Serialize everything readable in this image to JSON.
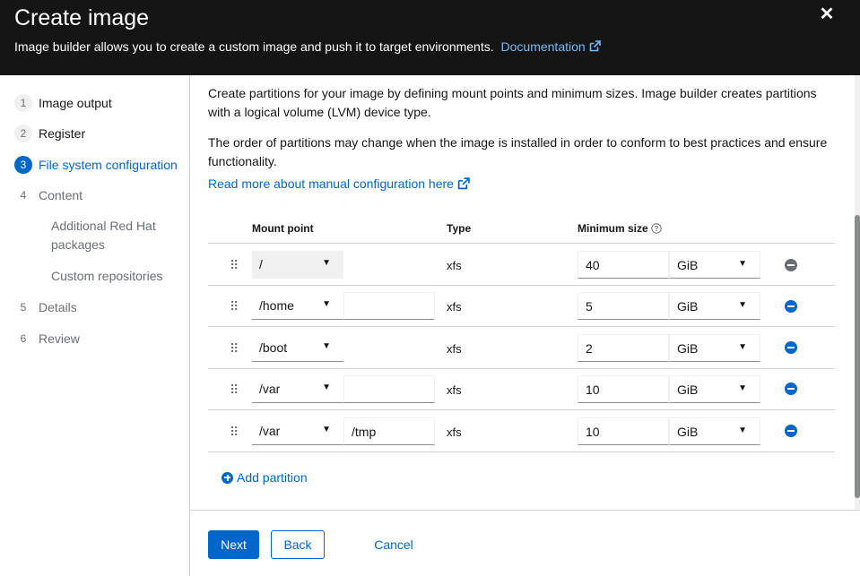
{
  "header": {
    "title": "Create image",
    "description": "Image builder allows you to create a custom image and push it to target environments.",
    "doc_link": "Documentation",
    "close_icon": "close-icon"
  },
  "nav": {
    "steps": [
      {
        "num": "1",
        "label": "Image output"
      },
      {
        "num": "2",
        "label": "Register"
      },
      {
        "num": "3",
        "label": "File system configuration"
      },
      {
        "num": "4",
        "label": "Content"
      },
      {
        "num": "5",
        "label": "Details"
      },
      {
        "num": "6",
        "label": "Review"
      }
    ],
    "substeps": [
      "Additional Red Hat packages",
      "Custom repositories"
    ]
  },
  "main": {
    "para1": "Create partitions for your image by defining mount points and minimum sizes. Image builder creates partitions with a logical volume (LVM) device type.",
    "para2": "The order of partitions may change when the image is installed in order to conform to best practices and ensure functionality.",
    "read_more": "Read more about manual configuration here",
    "table": {
      "headers": {
        "mount_point": "Mount point",
        "type": "Type",
        "min_size": "Minimum size"
      },
      "rows": [
        {
          "mount": "/",
          "sub": "",
          "type": "xfs",
          "size": "40",
          "unit": "GiB"
        },
        {
          "mount": "/home",
          "sub": "",
          "type": "xfs",
          "size": "5",
          "unit": "GiB"
        },
        {
          "mount": "/boot",
          "sub": "",
          "type": "xfs",
          "size": "2",
          "unit": "GiB"
        },
        {
          "mount": "/var",
          "sub": "",
          "type": "xfs",
          "size": "10",
          "unit": "GiB"
        },
        {
          "mount": "/var",
          "sub": "/tmp",
          "type": "xfs",
          "size": "10",
          "unit": "GiB"
        }
      ]
    },
    "add_partition": "Add partition"
  },
  "footer": {
    "next": "Next",
    "back": "Back",
    "cancel": "Cancel"
  },
  "colors": {
    "accent": "#0066cc",
    "header_bg": "#151515",
    "link_on_dark": "#73bcf7"
  }
}
